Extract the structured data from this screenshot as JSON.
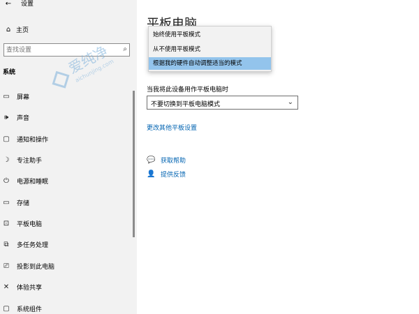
{
  "window": {
    "title": "设置",
    "back": "←",
    "minimize": "—",
    "maximize": "☐",
    "close": "✕"
  },
  "sidebar": {
    "home": {
      "icon": "⌂",
      "label": "主页"
    },
    "search": {
      "placeholder": "查找设置",
      "icon": "⌕"
    },
    "section": "系统",
    "items": [
      {
        "icon": "▭",
        "label": "屏幕"
      },
      {
        "icon": "🕪",
        "label": "声音"
      },
      {
        "icon": "▢",
        "label": "通知和操作"
      },
      {
        "icon": "☽",
        "label": "专注助手"
      },
      {
        "icon": "⏻",
        "label": "电源和睡眠"
      },
      {
        "icon": "▭",
        "label": "存储"
      },
      {
        "icon": "⊡",
        "label": "平板电脑"
      },
      {
        "icon": "⧉",
        "label": "多任务处理"
      },
      {
        "icon": "⎚",
        "label": "投影到此电脑"
      },
      {
        "icon": "✕",
        "label": "体验共享"
      },
      {
        "icon": "▢",
        "label": "系统组件"
      }
    ]
  },
  "watermark": {
    "brand": "爱纯净",
    "domain": "aichunjing.com"
  },
  "main": {
    "page_title": "平板电脑",
    "dropdown": {
      "options": [
        "始终使用平板模式",
        "从不使用平板模式",
        "根据我的硬件自动调整适当的模式"
      ],
      "selected_index": 2
    },
    "tablet_label": "当我将此设备用作平板电脑时",
    "tablet_combo": {
      "value": "不要切换到平板电脑模式",
      "icon": "⌄"
    },
    "more_link": "更改其他平板设置",
    "help": {
      "icon": "💬",
      "label": "获取帮助"
    },
    "feedback": {
      "icon": "👤",
      "label": "提供反馈"
    }
  },
  "colors": {
    "sidebar_bg": "#f2f2f2",
    "accent": "#0063b1",
    "selection": "#93c4ec"
  }
}
